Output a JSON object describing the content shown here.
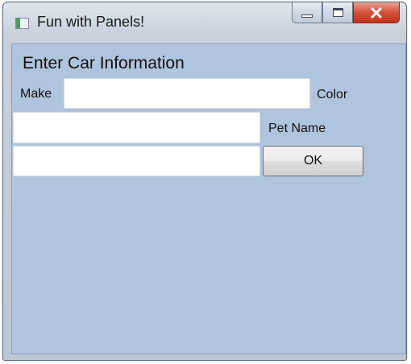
{
  "window": {
    "title": "Fun with Panels!",
    "caption_buttons": {
      "minimize_icon": "minimize-icon",
      "maximize_icon": "maximize-icon",
      "close_icon": "close-icon"
    },
    "app_icon": "window-app-icon"
  },
  "form": {
    "heading": "Enter Car Information",
    "make_label": "Make",
    "make_value": "",
    "color_label": "Color",
    "color_value": "",
    "pet_name_label": "Pet Name",
    "pet_name_value": "",
    "ok_label": "OK"
  },
  "colors": {
    "panel_background": "#b0c4de",
    "close_button": "#c4341c"
  }
}
